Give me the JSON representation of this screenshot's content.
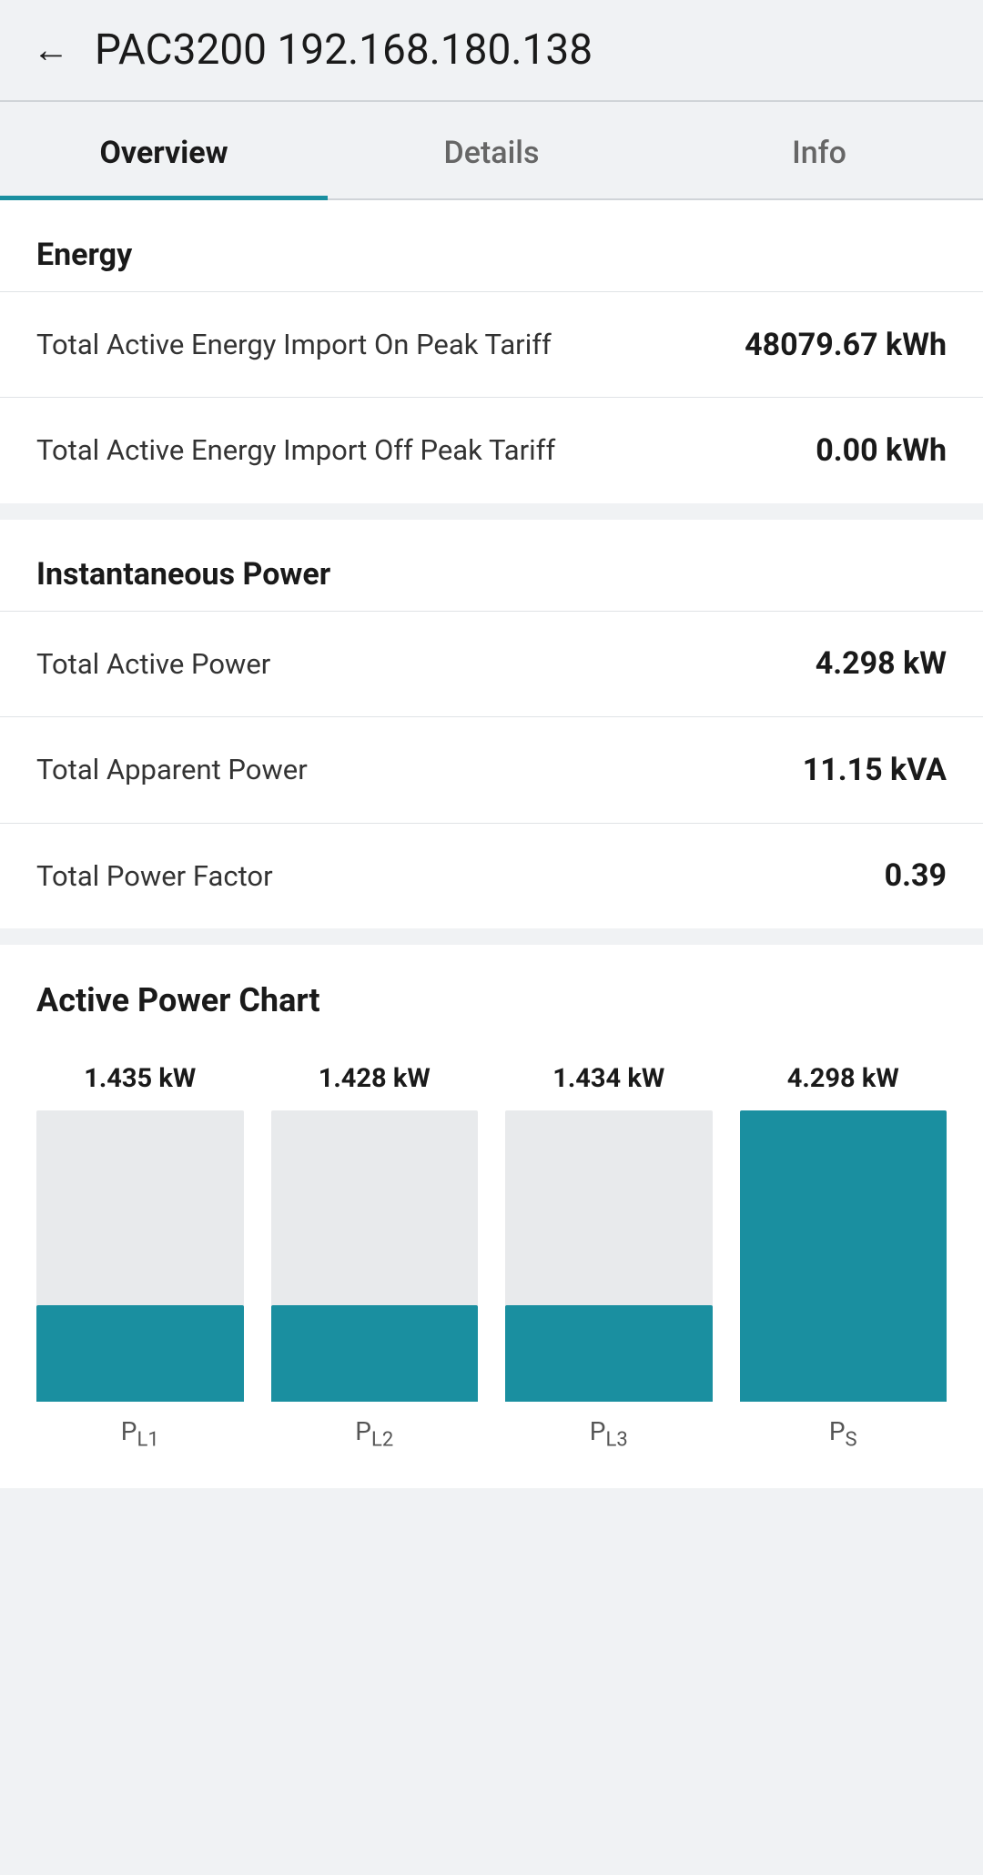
{
  "header": {
    "back_label": "←",
    "title": "PAC3200 192.168.180.138"
  },
  "tabs": [
    {
      "id": "overview",
      "label": "Overview",
      "active": true
    },
    {
      "id": "details",
      "label": "Details",
      "active": false
    },
    {
      "id": "info",
      "label": "Info",
      "active": false
    }
  ],
  "energy_section": {
    "title": "Energy",
    "rows": [
      {
        "label": "Total Active Energy Import On Peak Tariff",
        "value": "48079.67 kWh"
      },
      {
        "label": "Total Active Energy Import Off Peak Tariff",
        "value": "0.00 kWh"
      }
    ]
  },
  "instantaneous_section": {
    "title": "Instantaneous Power",
    "rows": [
      {
        "label": "Total Active Power",
        "value": "4.298 kW"
      },
      {
        "label": "Total Apparent Power",
        "value": "11.15 kVA"
      },
      {
        "label": "Total Power Factor",
        "value": "0.39"
      }
    ]
  },
  "chart_section": {
    "title": "Active Power Chart",
    "bars": [
      {
        "label": "P",
        "sub": "L1",
        "value_label": "1.435 kW",
        "fill_pct": 33
      },
      {
        "label": "P",
        "sub": "L2",
        "value_label": "1.428 kW",
        "fill_pct": 33
      },
      {
        "label": "P",
        "sub": "L3",
        "value_label": "1.434 kW",
        "fill_pct": 33
      },
      {
        "label": "P",
        "sub": "S",
        "value_label": "4.298 kW",
        "fill_pct": 100
      }
    ]
  }
}
